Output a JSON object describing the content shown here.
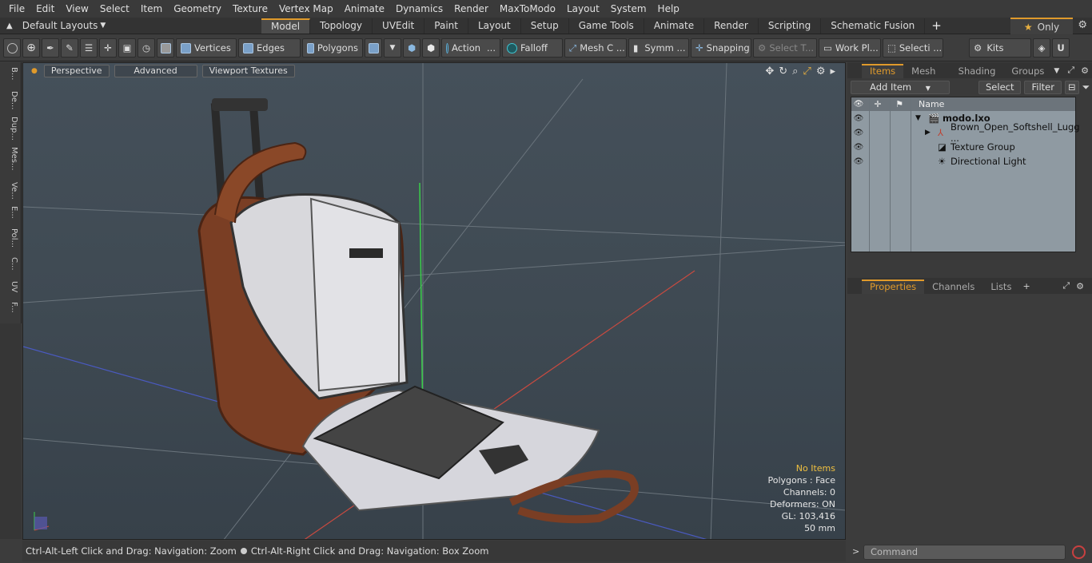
{
  "menu": [
    "File",
    "Edit",
    "View",
    "Select",
    "Item",
    "Geometry",
    "Texture",
    "Vertex Map",
    "Animate",
    "Dynamics",
    "Render",
    "MaxToModo",
    "Layout",
    "System",
    "Help"
  ],
  "layouts_label": "Default Layouts",
  "tabs": [
    "Model",
    "Topology",
    "UVEdit",
    "Paint",
    "Layout",
    "Setup",
    "Game Tools",
    "Animate",
    "Render",
    "Scripting",
    "Schematic Fusion"
  ],
  "only_label": "Only",
  "toolbar": {
    "vertices": "Vertices",
    "edges": "Edges",
    "polygons": "Polygons",
    "action": "Action",
    "falloff": "Falloff",
    "mesh": "Mesh C ...",
    "symm": "Symm ...",
    "snapping": "Snapping",
    "select_t": "Select T...",
    "work_plane": "Work Pl...",
    "selection": "Selecti ...",
    "kits": "Kits"
  },
  "left_tabs": [
    "B...",
    "De...",
    "Dup...",
    "Mes...",
    "Ve...",
    "E...",
    "Pol...",
    "C...",
    "UV",
    "F..."
  ],
  "viewport": {
    "perspective": "Perspective",
    "advanced": "Advanced",
    "textures": "Viewport Textures"
  },
  "hud": {
    "no_items": "No Items",
    "polygons": "Polygons : Face",
    "channels": "Channels: 0",
    "deformers": "Deformers: ON",
    "gl": "GL: 103,416",
    "size": "50 mm"
  },
  "status_left": "Ctrl-Alt-Left Click and Drag: Navigation: Zoom",
  "status_right": "Ctrl-Alt-Right Click and Drag: Navigation: Box Zoom",
  "panel_tabs": [
    "Items",
    "Mesh ...",
    "Shading",
    "Groups"
  ],
  "add_item": "Add Item",
  "select": "Select",
  "filter": "Filter",
  "col_name": "Name",
  "items": [
    "modo.lxo",
    "Brown_Open_Softshell_Lugg ...",
    "Texture Group",
    "Directional Light"
  ],
  "prop_tabs": [
    "Properties",
    "Channels",
    "Lists"
  ],
  "command_placeholder": "Command"
}
